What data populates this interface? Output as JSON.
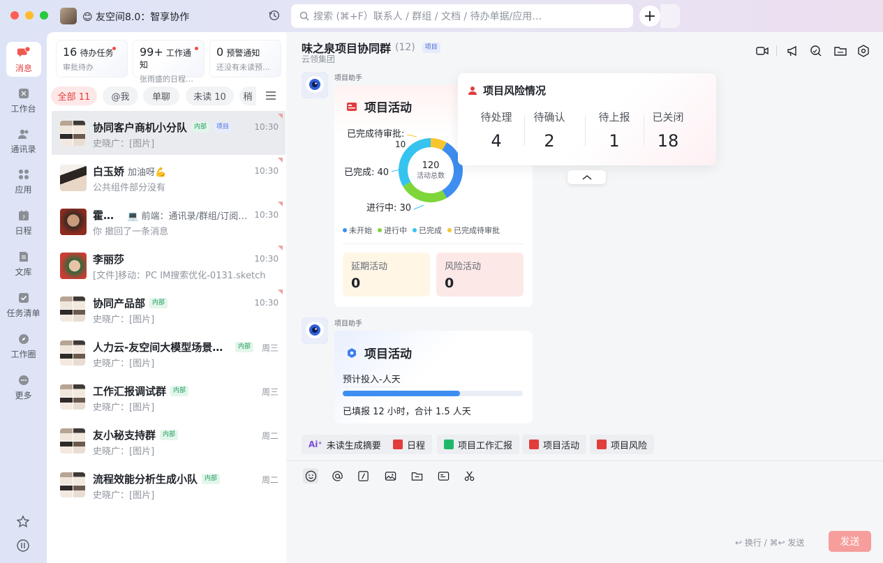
{
  "app": {
    "title": "😊 友空间8.0：智享协作"
  },
  "search": {
    "placeholder": "搜索 (⌘+F）联系人 / 群组 / 文档 / 待办单据/应用…"
  },
  "nav": {
    "items": [
      {
        "label": "消息",
        "icon": "message-icon"
      },
      {
        "label": "工作台",
        "icon": "workbench-icon"
      },
      {
        "label": "通讯录",
        "icon": "contacts-icon"
      },
      {
        "label": "应用",
        "icon": "apps-icon"
      },
      {
        "label": "日程",
        "icon": "calendar-icon"
      },
      {
        "label": "文库",
        "icon": "library-icon"
      },
      {
        "label": "任务清单",
        "icon": "tasklist-icon"
      },
      {
        "label": "工作圈",
        "icon": "circle-icon"
      },
      {
        "label": "更多",
        "icon": "more-icon"
      }
    ]
  },
  "stats": [
    {
      "count": "16",
      "label": "待办任务",
      "sub": "审批待办"
    },
    {
      "count": "99+",
      "label": "工作通知",
      "sub": "张雨盛的日程即..."
    },
    {
      "count": "0",
      "label": "预警通知",
      "sub": "还没有未读预警~"
    }
  ],
  "filters": [
    "全部 11",
    "@我",
    "单聊",
    "未读 10",
    "稍"
  ],
  "conversations": [
    {
      "name": "协同客户商机小分队",
      "tags": [
        "内部",
        "项目"
      ],
      "preview": "史晓广：[图片]",
      "time": "10:30"
    },
    {
      "name": "白玉娇",
      "extra": "加油呀💪",
      "preview": "公共组件部分没有",
      "time": "10:30"
    },
    {
      "name": "霍小浩",
      "extra": "💻 前端：通讯录/群组/订阅号...",
      "preview": "你 撤回了一条消息",
      "time": "10:30"
    },
    {
      "name": "李丽莎",
      "preview": "[文件]移动：PC IM搜索优化-0131.sketch",
      "time": "10:30"
    },
    {
      "name": "协同产品部",
      "tags": [
        "内部"
      ],
      "preview": "史晓广：[图片]",
      "time": "10:30"
    },
    {
      "name": "人力云-友空间大模型场景共...",
      "tags": [
        "内部"
      ],
      "preview": "史晓广：[图片]",
      "time": "周三"
    },
    {
      "name": "工作汇报调试群",
      "tags": [
        "内部"
      ],
      "preview": "史晓广：[图片]",
      "time": "周三"
    },
    {
      "name": "友小秘支持群",
      "tags": [
        "内部"
      ],
      "preview": "史晓广：[图片]",
      "time": "周二"
    },
    {
      "name": "流程效能分析生成小队",
      "tags": [
        "内部"
      ],
      "preview": "史晓广：[图片]",
      "time": "周二"
    }
  ],
  "chat": {
    "title": "味之泉项目协同群",
    "member_count": "(12)",
    "tag": "项目",
    "subtitle": "云领集团",
    "bot_name": "项目助手",
    "activity_card": {
      "title": "项目活动",
      "center_value": "120",
      "center_label": "活动总数",
      "label_pending_approval": "已完成待审批:",
      "label_pending_approval_val": "10",
      "label_done": "已完成: 40",
      "label_inprogress": "进行中: 30",
      "legend": [
        "未开始",
        "进行中",
        "已完成",
        "已完成待审批"
      ],
      "delayed_label": "延期活动",
      "delayed_value": "0",
      "risk_label": "风险活动",
      "risk_value": "0"
    },
    "effort_card": {
      "title": "项目活动",
      "label": "预计投入-人天",
      "progress": 0.65,
      "summary": "已填报 12 小时，合计 1.5 人天"
    },
    "risk_popup": {
      "title": "项目风险情况",
      "cols": [
        {
          "label": "待处理",
          "value": "4"
        },
        {
          "label": "待确认",
          "value": "2"
        },
        {
          "label": "待上报",
          "value": "1"
        },
        {
          "label": "已关闭",
          "value": "18"
        }
      ]
    },
    "quick_actions": [
      "未读生成摘要",
      "日程",
      "项目工作汇报",
      "项目活动",
      "项目风险"
    ],
    "input_hint": "↩ 换行 / ⌘↩ 发送",
    "send_label": "发送"
  },
  "chart_data": {
    "type": "pie",
    "title": "项目活动",
    "categories": [
      "未开始",
      "进行中",
      "已完成",
      "已完成待审批"
    ],
    "values": [
      40,
      30,
      40,
      10
    ],
    "total": 120,
    "colors": [
      "#3d8ef0",
      "#7ed63a",
      "#36c3f0",
      "#f7c52f"
    ]
  }
}
